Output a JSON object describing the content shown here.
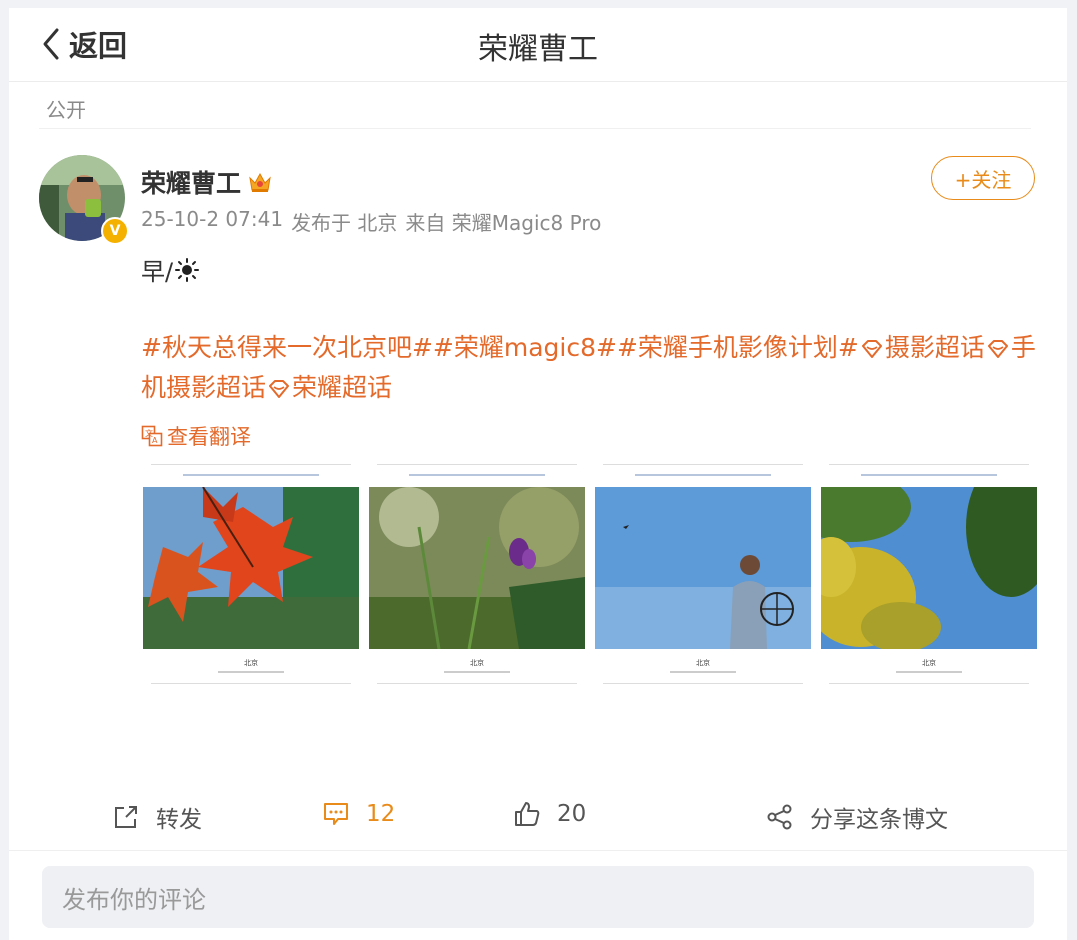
{
  "header": {
    "back_label": "返回",
    "title": "荣耀曹工"
  },
  "visibility": "公开",
  "post": {
    "username": "荣耀曹工",
    "follow_label": "+关注",
    "timestamp": "25-10-2 07:41",
    "location": "发布于 北京",
    "source": "来自 荣耀Magic8 Pro",
    "text": "早/",
    "tags": {
      "tag1": "#秋天总得来一次北京吧#",
      "tag2": "#荣耀magic8#",
      "tag3": "#荣耀手机影像计划#",
      "super1": "摄影超话",
      "super2": "手机摄影超话",
      "super3": "荣耀超话"
    },
    "translate_label": "查看翻译",
    "images": [
      {
        "caption": "北京",
        "subject": "red maple leaves"
      },
      {
        "caption": "北京",
        "subject": "purple flower"
      },
      {
        "caption": "北京",
        "subject": "man with kite reel"
      },
      {
        "caption": "北京",
        "subject": "yellow autumn tree"
      }
    ]
  },
  "actions": {
    "repost_label": "转发",
    "comment_count": "12",
    "like_count": "20",
    "share_label": "分享这条博文"
  },
  "comment_input": {
    "placeholder": "发布你的评论"
  },
  "colors": {
    "accent": "#e88b1a",
    "topic": "#e36a2b",
    "verified": "#f5b100"
  }
}
